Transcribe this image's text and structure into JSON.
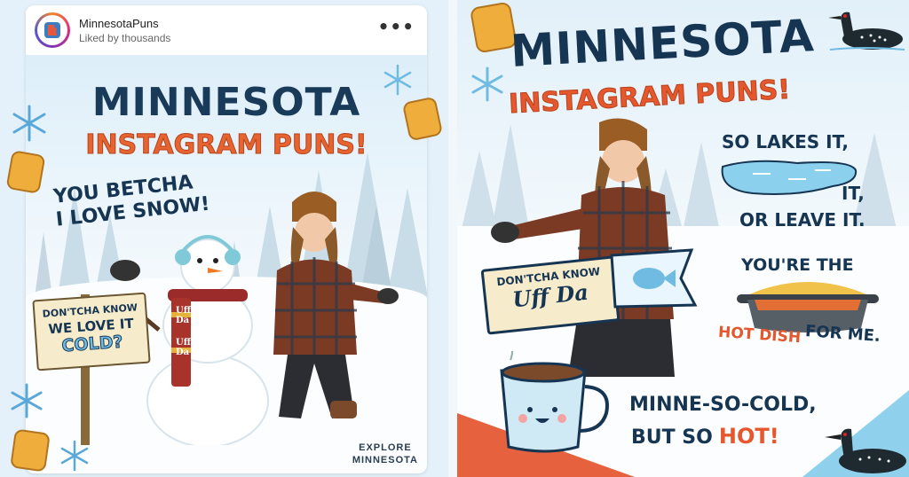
{
  "left_post": {
    "account_name": "MinnesotaPuns",
    "liked_by": "Liked by thousands",
    "more_icon": "more-horizontal-icon",
    "title_line1": "MINNESOTA",
    "title_line2": "INSTAGRAM PUNS!",
    "speech_line1": "YOU BETCHA",
    "speech_line2": "I LOVE SNOW!",
    "scarf_text1": "Uff",
    "scarf_text2": "Da",
    "scarf_text3": "Uff",
    "scarf_text4": "Da",
    "sign_line1": "DON'TCHA KNOW",
    "sign_line2": "WE LOVE IT",
    "sign_line3": "COLD?",
    "explore_line1": "EXPLORE",
    "explore_line2": "MINNESOTA"
  },
  "right_post": {
    "title_line1": "MINNESOTA",
    "title_line2": "INSTAGRAM PUNS!",
    "lakes_line1": "SO LAKES IT,",
    "lakes_line2": "IT,",
    "lakes_line3": "OR LEAVE IT.",
    "banner_line1": "DON'TCHA KNOW",
    "banner_line2": "Uff Da",
    "hotdish_line1": "YOU'RE THE",
    "hotdish_line2": "HOT DISH",
    "hotdish_line3": "FOR ME.",
    "cold_line1": "MINNE-SO-COLD,",
    "cold_line2": "BUT SO",
    "cold_line3": "HOT!"
  },
  "colors": {
    "navy": "#163553",
    "orange": "#e5572c",
    "ice_blue": "#6fc3e8",
    "plaid_red": "#8a3a22"
  }
}
